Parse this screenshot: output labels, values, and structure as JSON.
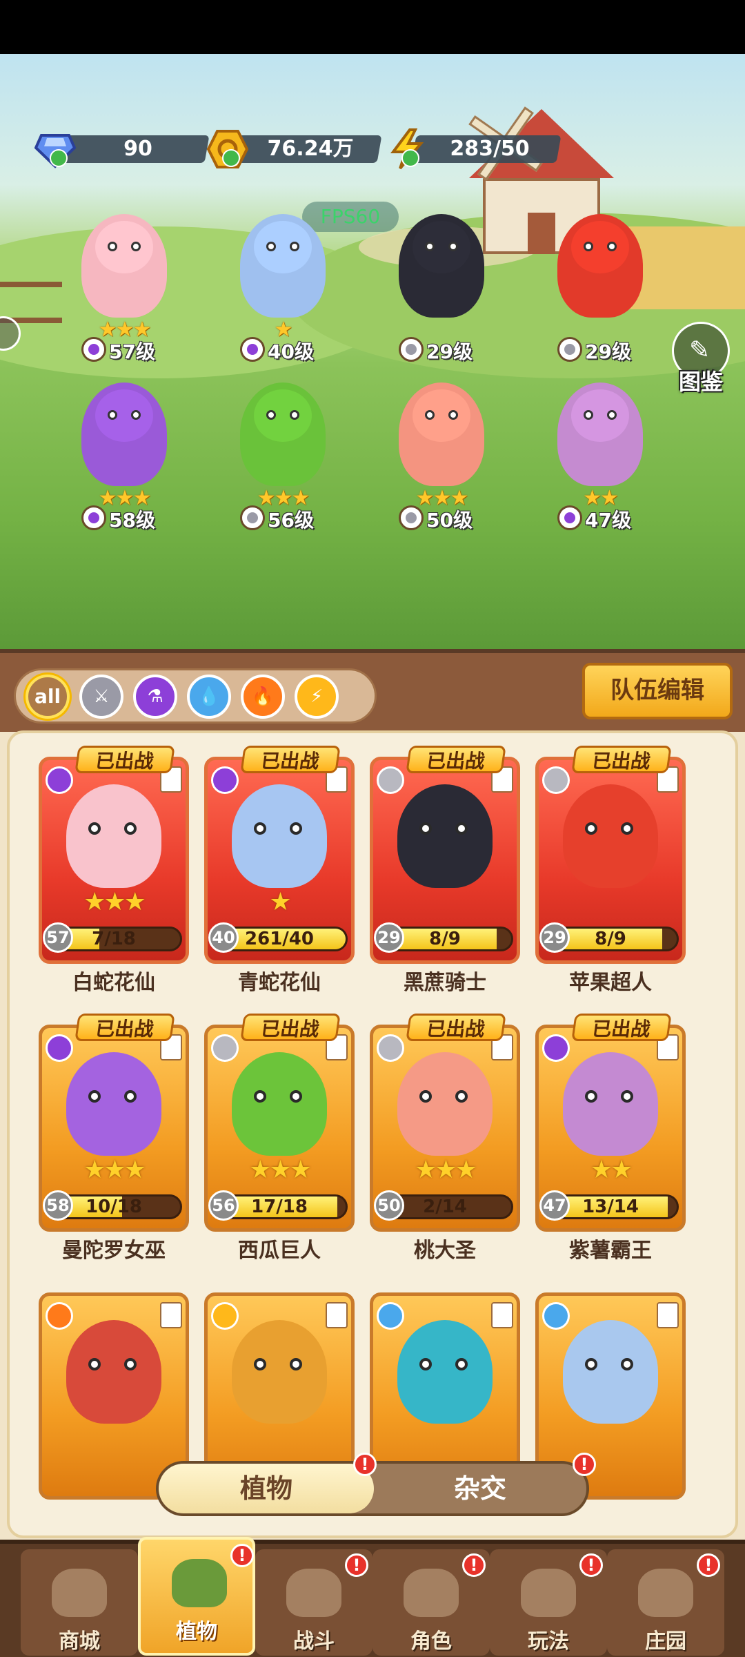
{
  "resources": {
    "gems": "90",
    "coins": "76.24万",
    "energy": "283/50"
  },
  "fps": "FPS60",
  "atlas_label": "图鉴",
  "field_heroes": [
    {
      "level": "57级",
      "stars": 3,
      "type": "potion",
      "color": "#f6b7c0"
    },
    {
      "level": "40级",
      "stars": 1,
      "type": "potion",
      "color": "#9fc0ef"
    },
    {
      "level": "29级",
      "stars": 0,
      "type": "sword",
      "color": "#2a2a35"
    },
    {
      "level": "29级",
      "stars": 0,
      "type": "sword",
      "color": "#e23a2a"
    },
    {
      "level": "58级",
      "stars": 3,
      "type": "potion",
      "color": "#9a5ad8"
    },
    {
      "level": "56级",
      "stars": 3,
      "type": "sword",
      "color": "#6ac23a"
    },
    {
      "level": "50级",
      "stars": 3,
      "type": "sword",
      "color": "#f49480"
    },
    {
      "level": "47级",
      "stars": 2,
      "type": "potion",
      "color": "#c58bd0"
    }
  ],
  "filters": [
    "all",
    "sword",
    "potion",
    "water",
    "fire",
    "bolt"
  ],
  "team_edit_label": "队伍编辑",
  "deployed_label": "已出战",
  "cards": [
    {
      "name": "白蛇花仙",
      "level": "57",
      "progress": "7/18",
      "ratio": 0.39,
      "stars": 3,
      "theme": "red",
      "type": "potion",
      "color": "#f9c3cc",
      "deployed": true
    },
    {
      "name": "青蛇花仙",
      "level": "40",
      "progress": "261/40",
      "ratio": 1.0,
      "stars": 1,
      "theme": "red",
      "type": "potion",
      "color": "#a7c6f2",
      "deployed": true
    },
    {
      "name": "黑蔗骑士",
      "level": "29",
      "progress": "8/9",
      "ratio": 0.89,
      "stars": 0,
      "theme": "red",
      "type": "sword",
      "color": "#2a2a35",
      "deployed": true
    },
    {
      "name": "苹果超人",
      "level": "29",
      "progress": "8/9",
      "ratio": 0.89,
      "stars": 0,
      "theme": "red",
      "type": "sword",
      "color": "#e6402c",
      "deployed": true
    },
    {
      "name": "曼陀罗女巫",
      "level": "58",
      "progress": "10/18",
      "ratio": 0.56,
      "stars": 3,
      "theme": "gold",
      "type": "potion",
      "color": "#a463e0",
      "deployed": true
    },
    {
      "name": "西瓜巨人",
      "level": "56",
      "progress": "17/18",
      "ratio": 0.94,
      "stars": 3,
      "theme": "gold",
      "type": "sword",
      "color": "#6cc43a",
      "deployed": true
    },
    {
      "name": "桃大圣",
      "level": "50",
      "progress": "2/14",
      "ratio": 0.14,
      "stars": 3,
      "theme": "gold",
      "type": "sword",
      "color": "#f59a86",
      "deployed": true
    },
    {
      "name": "紫薯霸王",
      "level": "47",
      "progress": "13/14",
      "ratio": 0.93,
      "stars": 2,
      "theme": "gold",
      "type": "potion",
      "color": "#c48ad2",
      "deployed": true
    },
    {
      "name": "",
      "level": "",
      "progress": "",
      "ratio": 0,
      "stars": 0,
      "theme": "gold",
      "type": "fire",
      "color": "#d84a3a",
      "deployed": false
    },
    {
      "name": "",
      "level": "",
      "progress": "",
      "ratio": 0,
      "stars": 0,
      "theme": "gold",
      "type": "bolt",
      "color": "#e8a030",
      "deployed": false
    },
    {
      "name": "",
      "level": "",
      "progress": "",
      "ratio": 0,
      "stars": 0,
      "theme": "gold",
      "type": "water",
      "color": "#36b6c8",
      "deployed": false
    },
    {
      "name": "",
      "level": "",
      "progress": "",
      "ratio": 0,
      "stars": 0,
      "theme": "gold",
      "type": "water",
      "color": "#a9c8ee",
      "deployed": false
    }
  ],
  "switch": {
    "plants": "植物",
    "hybrid": "杂交"
  },
  "nav": [
    "商城",
    "植物",
    "战斗",
    "角色",
    "玩法",
    "庄园"
  ],
  "nav_active": "植物",
  "notice_mark": "!"
}
